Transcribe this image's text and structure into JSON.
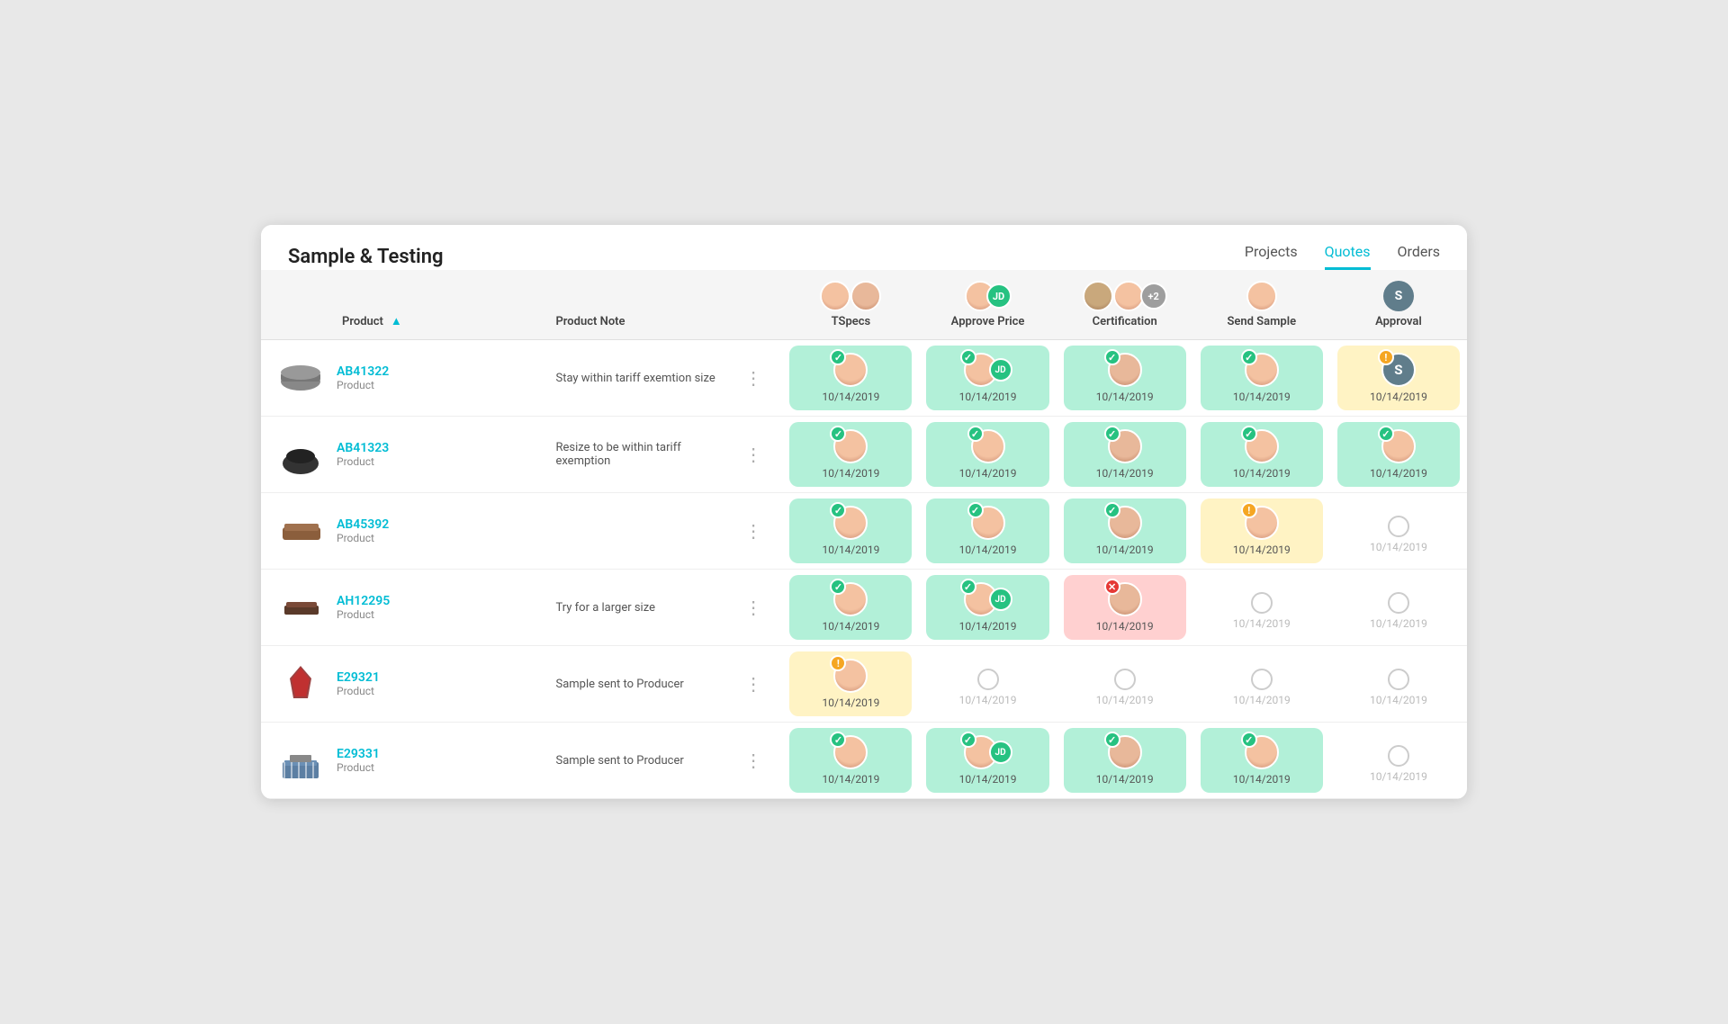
{
  "app": {
    "title": "Sample & Testing"
  },
  "nav": {
    "tabs": [
      {
        "label": "Projects",
        "active": false
      },
      {
        "label": "Quotes",
        "active": true
      },
      {
        "label": "Orders",
        "active": false
      }
    ]
  },
  "table": {
    "columns": [
      {
        "id": "product",
        "label": "Product",
        "sortable": true
      },
      {
        "id": "note",
        "label": "Product Note"
      },
      {
        "id": "tspecs",
        "label": "TSpecs"
      },
      {
        "id": "approve",
        "label": "Approve Price"
      },
      {
        "id": "cert",
        "label": "Certification"
      },
      {
        "id": "send",
        "label": "Send Sample"
      },
      {
        "id": "approval",
        "label": "Approval"
      }
    ],
    "rows": [
      {
        "code": "AB41322",
        "type": "Product",
        "note": "Stay within tariff exemtion size",
        "tspecs": {
          "status": "green",
          "date": "10/14/2019",
          "icon": "check"
        },
        "approve": {
          "status": "green",
          "date": "10/14/2019",
          "icon": "check",
          "initials": "JD"
        },
        "cert": {
          "status": "green",
          "date": "10/14/2019",
          "icon": "check"
        },
        "send": {
          "status": "green",
          "date": "10/14/2019",
          "icon": "check"
        },
        "approval": {
          "status": "yellow",
          "date": "10/14/2019",
          "icon": "warn",
          "initial": "S"
        }
      },
      {
        "code": "AB41323",
        "type": "Product",
        "note": "Resize to be within tariff exemption",
        "tspecs": {
          "status": "green",
          "date": "10/14/2019",
          "icon": "check"
        },
        "approve": {
          "status": "green",
          "date": "10/14/2019",
          "icon": "check"
        },
        "cert": {
          "status": "green",
          "date": "10/14/2019",
          "icon": "check"
        },
        "send": {
          "status": "green",
          "date": "10/14/2019",
          "icon": "check"
        },
        "approval": {
          "status": "green",
          "date": "10/14/2019",
          "icon": "check"
        }
      },
      {
        "code": "AB45392",
        "type": "Product",
        "note": "",
        "tspecs": {
          "status": "green",
          "date": "10/14/2019",
          "icon": "check"
        },
        "approve": {
          "status": "green",
          "date": "10/14/2019",
          "icon": "check"
        },
        "cert": {
          "status": "green",
          "date": "10/14/2019",
          "icon": "check"
        },
        "send": {
          "status": "yellow",
          "date": "10/14/2019",
          "icon": "warn"
        },
        "approval": {
          "status": "empty",
          "date": "10/14/2019"
        }
      },
      {
        "code": "AH12295",
        "type": "Product",
        "note": "Try for a larger size",
        "tspecs": {
          "status": "green",
          "date": "10/14/2019",
          "icon": "check"
        },
        "approve": {
          "status": "green",
          "date": "10/14/2019",
          "icon": "check",
          "initials": "JD"
        },
        "cert": {
          "status": "red",
          "date": "10/14/2019",
          "icon": "error"
        },
        "send": {
          "status": "empty",
          "date": "10/14/2019"
        },
        "approval": {
          "status": "empty",
          "date": "10/14/2019"
        }
      },
      {
        "code": "E29321",
        "type": "Product",
        "note": "Sample sent to Producer",
        "tspecs": {
          "status": "yellow",
          "date": "10/14/2019",
          "icon": "warn"
        },
        "approve": {
          "status": "empty",
          "date": "10/14/2019"
        },
        "cert": {
          "status": "empty",
          "date": "10/14/2019"
        },
        "send": {
          "status": "empty",
          "date": "10/14/2019"
        },
        "approval": {
          "status": "empty",
          "date": "10/14/2019"
        }
      },
      {
        "code": "E29331",
        "type": "Product",
        "note": "Sample sent to Producer",
        "tspecs": {
          "status": "green",
          "date": "10/14/2019",
          "icon": "check"
        },
        "approve": {
          "status": "green",
          "date": "10/14/2019",
          "icon": "check",
          "initials": "JD"
        },
        "cert": {
          "status": "green",
          "date": "10/14/2019",
          "icon": "check"
        },
        "send": {
          "status": "green",
          "date": "10/14/2019",
          "icon": "check"
        },
        "approval": {
          "status": "empty",
          "date": "10/14/2019"
        }
      }
    ]
  },
  "icons": {
    "check": "✓",
    "warn": "!",
    "error": "✕",
    "menu": "⋮",
    "sort_asc": "▲"
  },
  "colors": {
    "teal": "#00bcd4",
    "green_bg": "#b2f0d8",
    "yellow_bg": "#fff3c4",
    "red_bg": "#ffd0d0",
    "check_green": "#26c281",
    "warn_orange": "#f5a623",
    "error_red": "#e53935",
    "jd_green": "#26c281",
    "s_blue": "#607d8b"
  }
}
